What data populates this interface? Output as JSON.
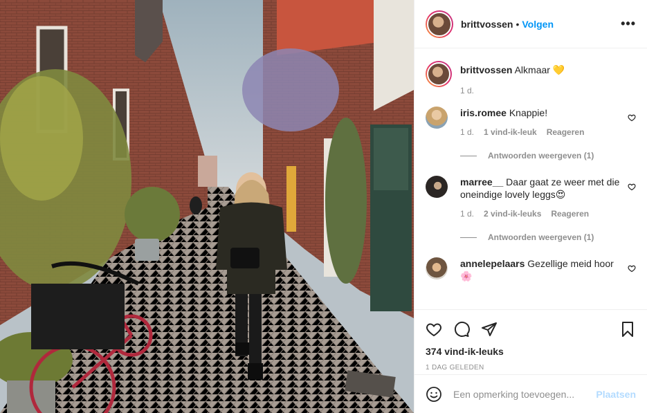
{
  "post": {
    "username": "brittvossen",
    "follow_dot": "•",
    "follow_label": "Volgen",
    "more_icon": "more-options-icon",
    "more_symbol": "•••"
  },
  "caption": {
    "username": "brittvossen",
    "text": "Alkmaar 💛",
    "age": "1 d."
  },
  "comments": [
    {
      "username": "iris.romee",
      "text": "Knappie!",
      "age": "1 d.",
      "likes": "1 vind-ik-leuk",
      "reply": "Reageren",
      "view_replies": "Antwoorden weergeven (1)"
    },
    {
      "username": "marree__",
      "text": "Daar gaat ze weer met die oneindige lovely leggs😍",
      "age": "1 d.",
      "likes": "2 vind-ik-leuks",
      "reply": "Reageren",
      "view_replies": "Antwoorden weergeven (1)"
    },
    {
      "username": "annelepelaars",
      "text": "Gezellige meid hoor 🌸"
    }
  ],
  "actions": {
    "like_icon": "heart-icon",
    "comment_icon": "comment-icon",
    "share_icon": "share-icon",
    "save_icon": "bookmark-icon",
    "likes_count": "374 vind-ik-leuks",
    "posted": "1 DAG GELEDEN"
  },
  "add_comment": {
    "emoji_icon": "emoji-icon",
    "placeholder": "Een opmerking toevoegen...",
    "post_label": "Plaatsen"
  },
  "colors": {
    "accent": "#0095f6",
    "post_disabled": "#b3dbff",
    "muted": "#8e8e8e",
    "text": "#262626"
  }
}
